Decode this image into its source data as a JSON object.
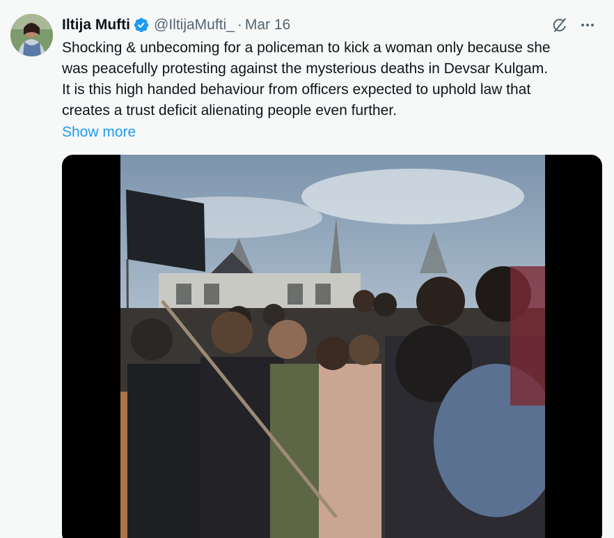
{
  "tweet": {
    "author_name": "Iltija Mufti",
    "handle": "@IltijaMufti_",
    "separator": "·",
    "date": "Mar 16",
    "verified": true,
    "text": "Shocking & unbecoming for a policeman to kick a woman only because she\nwas peacefully protesting against the mysterious deaths in Devsar Kulgam.\nIt is this high handed behaviour from officers expected to uphold law that\ncreates a trust deficit alienating people even further.",
    "show_more_label": "Show more"
  },
  "icons": {
    "avatar": "avatar-photo",
    "verified": "verified-badge-icon",
    "grok": "grok-icon",
    "more": "more-options-icon"
  },
  "colors": {
    "background": "#f7f9f9",
    "text": "#0f1419",
    "muted": "#536471",
    "link": "#1d9bf0",
    "verified": "#1d9bf0",
    "media_bg": "#000000"
  }
}
